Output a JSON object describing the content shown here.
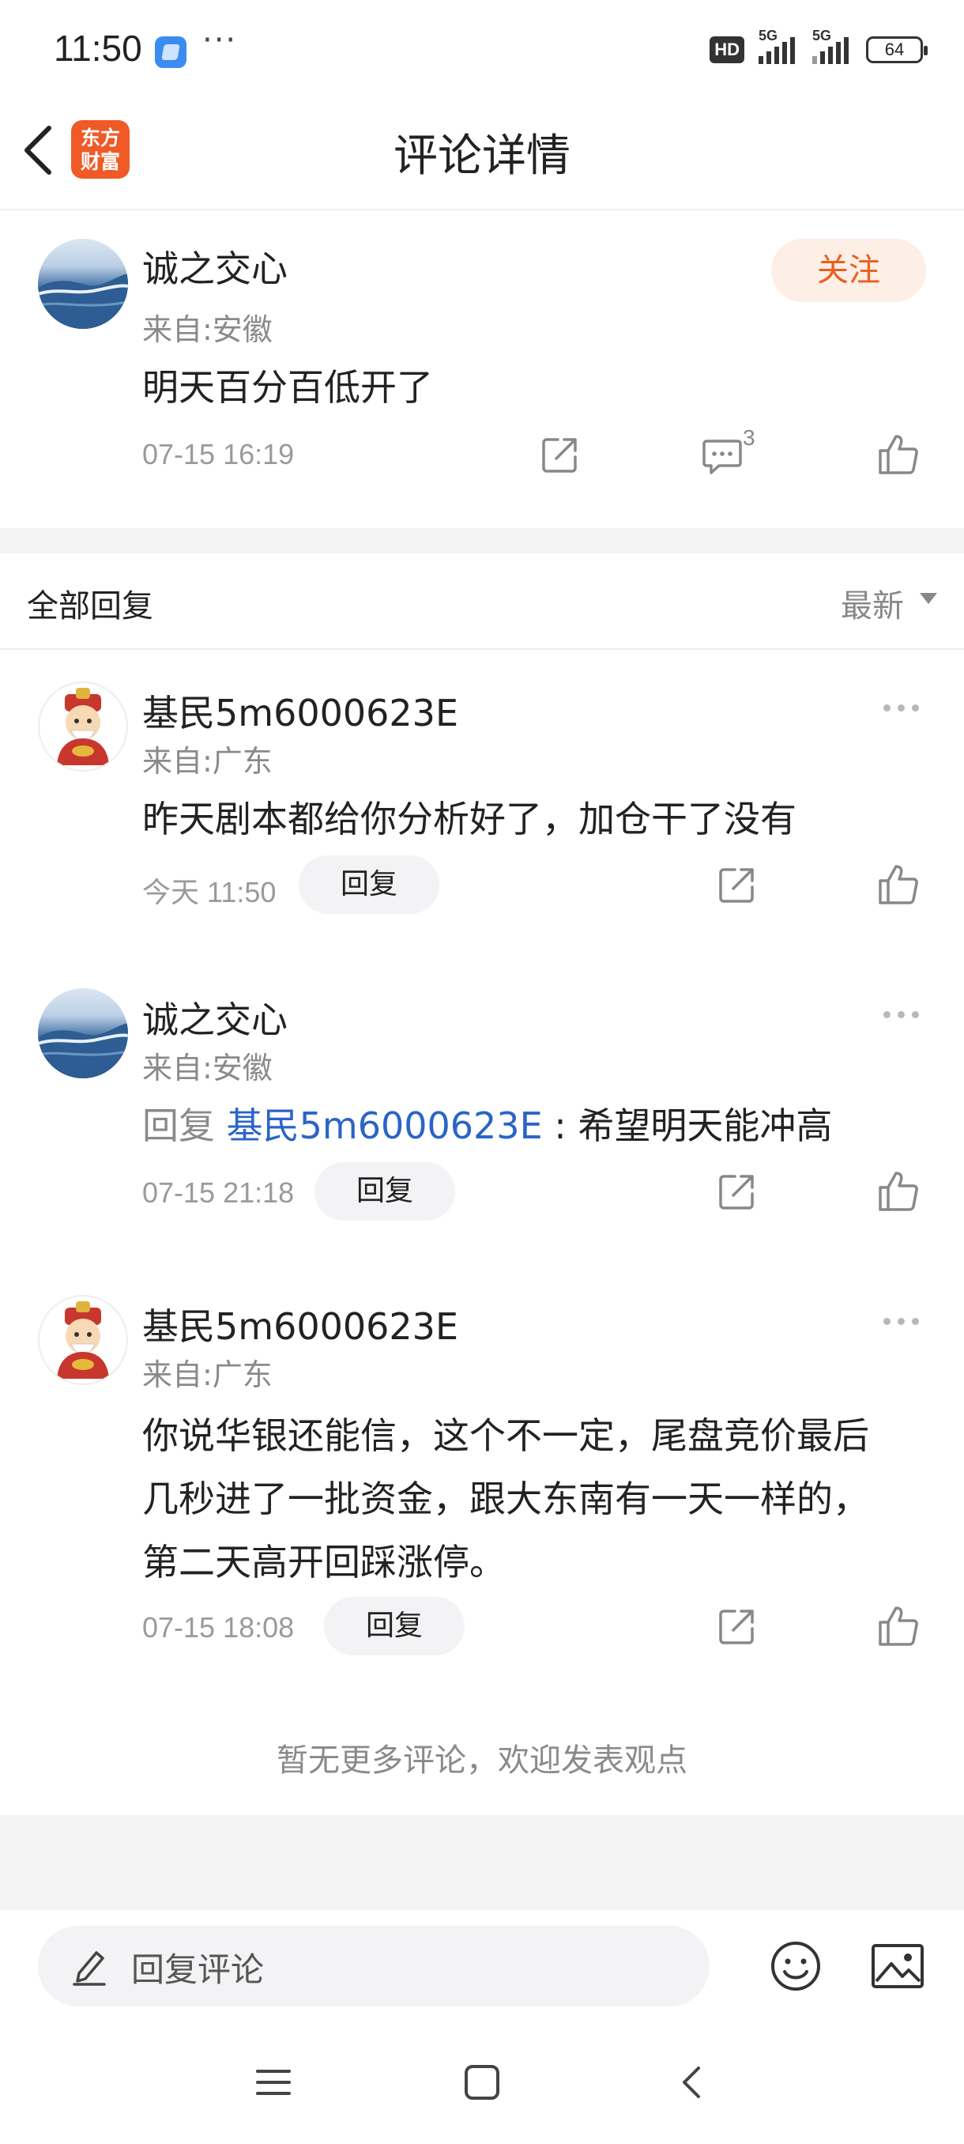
{
  "status_bar": {
    "time": "11:50",
    "dots": "···",
    "hd_label": "HD",
    "net1": "5G",
    "net2": "5G",
    "battery": "64"
  },
  "header": {
    "title": "评论详情",
    "logo_line1": "东方",
    "logo_line2": "财富"
  },
  "main_comment": {
    "username": "诚之交心",
    "location": "来自:安徽",
    "follow_label": "关注",
    "content": "明天百分百低开了",
    "time": "07-15 16:19",
    "reply_count": "3"
  },
  "replies_section": {
    "title": "全部回复",
    "sort_label": "最新"
  },
  "replies": [
    {
      "username": "基民5m6000623E",
      "location": "来自:广东",
      "content": "昨天剧本都给你分析好了，加仓干了没有",
      "time": "今天 11:50",
      "reply_label": "回复"
    },
    {
      "username": "诚之交心",
      "location": "来自:安徽",
      "reply_prefix": "回复",
      "reply_to": "基民5m6000623E",
      "reply_sep": " : ",
      "content": "希望明天能冲高",
      "time": "07-15 21:18",
      "reply_label": "回复"
    },
    {
      "username": "基民5m6000623E",
      "location": "来自:广东",
      "content_lines": [
        "你说华银还能信，这个不一定，尾盘竞价最后",
        "几秒进了一批资金，跟大东南有一天一样的，",
        "第二天高开回踩涨停。"
      ],
      "time": "07-15 18:08",
      "reply_label": "回复"
    }
  ],
  "end_text": "暂无更多评论，欢迎发表观点",
  "bottom_bar": {
    "input_placeholder": "回复评论"
  },
  "colors": {
    "accent_orange": "#ea5f1f",
    "follow_bg": "#fdeee6",
    "link_blue": "#2a64c8"
  }
}
